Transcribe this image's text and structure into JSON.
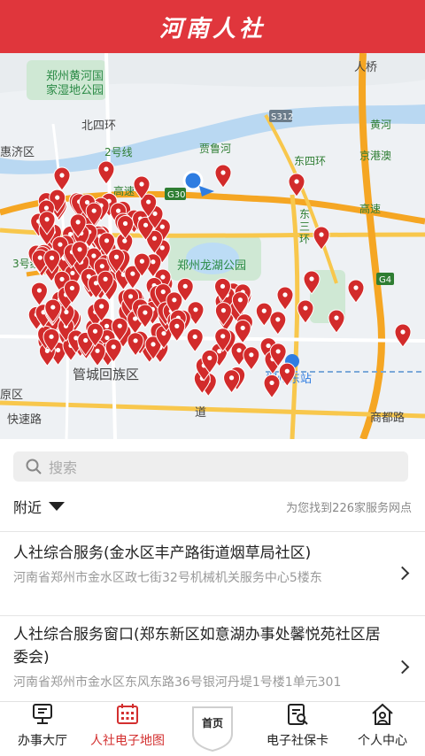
{
  "header": {
    "title": "河南人社"
  },
  "map": {
    "labels": {
      "park1_line1": "郑州黄河国",
      "park1_line2": "家湿地公园",
      "beisihuan": "北四环",
      "jiqu": "惠济区",
      "road2": "2号线",
      "jialuhe": "贾鲁河",
      "dongsihuan": "东四环",
      "s312": "S312",
      "huanghe": "黄河",
      "jinggang_line1": "京港澳",
      "jinggang_line2": "高速",
      "g30": "G30",
      "dongsanhuan1": "东",
      "dongsanhuan2": "三",
      "dongsanhuan3": "环",
      "longhu": "郑州龙湖公园",
      "g4": "G4",
      "guancheng": "管城回族区",
      "zhengzhoudong": "郑州东站",
      "road3": "3号线",
      "shangdu": "商都路",
      "yuanqu": "原区",
      "kuaisu": "快速路",
      "dao": "道",
      "renqiao": "人桥",
      "gaosu": "高速"
    },
    "pin_color": "#d22b2b",
    "location_color": "#2f7de1"
  },
  "search": {
    "placeholder": "搜索"
  },
  "filter": {
    "nearby_label": "附近",
    "found_text": "为您找到226家服务网点"
  },
  "list": [
    {
      "title": "人社综合服务(金水区丰产路街道烟草局社区)",
      "address": "河南省郑州市金水区政七街32号机械机关服务中心5楼东"
    },
    {
      "title": "人社综合服务窗口(郑东新区如意湖办事处馨悦苑社区居委会)",
      "address": "河南省郑州市金水区东风东路36号银河丹堤1号楼1单元301"
    }
  ],
  "nav": {
    "items": [
      {
        "label": "办事大厅",
        "icon": "monitor-icon"
      },
      {
        "label": "人社电子地图",
        "icon": "calendar-map-icon"
      },
      {
        "label": "首页",
        "icon": "home-badge-icon"
      },
      {
        "label": "电子社保卡",
        "icon": "card-search-icon"
      },
      {
        "label": "个人中心",
        "icon": "house-person-icon"
      }
    ],
    "active_index": 1,
    "active_color": "#d32f2f"
  }
}
